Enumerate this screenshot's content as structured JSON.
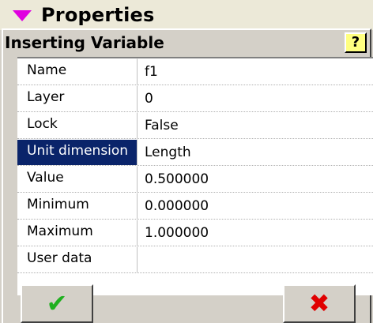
{
  "header": {
    "title": "Properties"
  },
  "panel": {
    "caption": "Inserting Variable",
    "help_label": "?"
  },
  "properties": [
    {
      "name": "Name",
      "value": "f1"
    },
    {
      "name": "Layer",
      "value": "0"
    },
    {
      "name": "Lock",
      "value": "False"
    },
    {
      "name": "Unit dimension",
      "value": "Length",
      "selected": true
    },
    {
      "name": "Value",
      "value": "0.500000"
    },
    {
      "name": "Minimum",
      "value": "0.000000"
    },
    {
      "name": "Maximum",
      "value": "1.000000"
    },
    {
      "name": "User data",
      "value": ""
    }
  ],
  "buttons": {
    "ok_glyph": "✔",
    "cancel_glyph": "✖"
  },
  "colors": {
    "selection": "#0a246a",
    "ok": "#20b020",
    "cancel": "#e00000",
    "arrow": "#e000e0"
  }
}
